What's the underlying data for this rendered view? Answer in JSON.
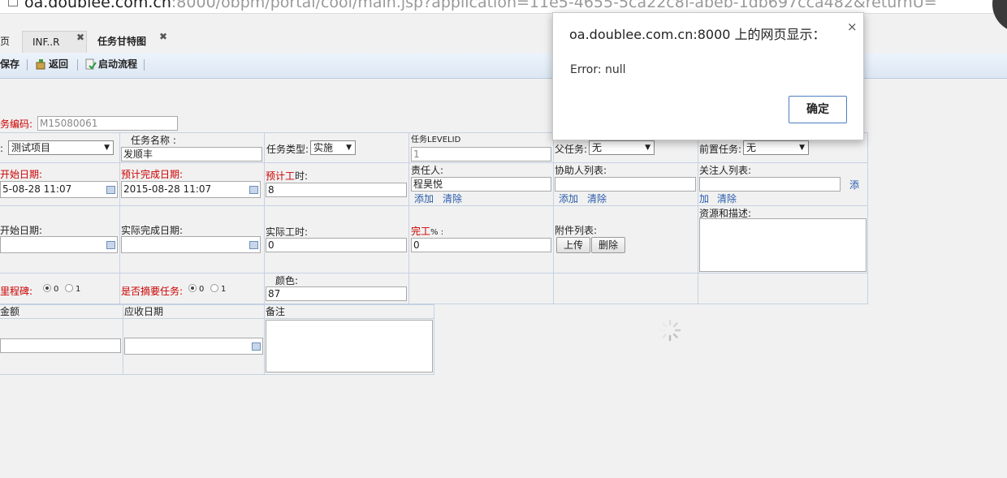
{
  "address_bar": {
    "host": "oa.doublee.com.cn",
    "rest": ":8000/obpm/portal/cool/main.jsp?application=11e5-4655-5ca22c8f-abeb-1db697cca482&returnU="
  },
  "tabs": [
    {
      "label": "页",
      "closable": false
    },
    {
      "label": "INF..R",
      "closable": true
    },
    {
      "label": "任务甘特图",
      "closable": true
    }
  ],
  "toolbar": {
    "save_label": "保存",
    "back_label": "返回",
    "start_flow_label": "启动流程"
  },
  "form": {
    "task_code": {
      "label": "务编码:",
      "value": "M15080061"
    },
    "project": {
      "value": "测试项目"
    },
    "task_name": {
      "label": "任务名称 :",
      "value": "发顺丰"
    },
    "task_type": {
      "label": "任务类型:",
      "value": "实施"
    },
    "task_level": {
      "label": "任务LEVELID",
      "value": "1"
    },
    "parent_task": {
      "label": "父任务:",
      "value": "无"
    },
    "pre_task": {
      "label": "前置任务:",
      "value": "无"
    },
    "plan_start": {
      "label": "开始日期:",
      "value": "5-08-28 11:07"
    },
    "plan_finish": {
      "label": "预计完成日期:",
      "value": "2015-08-28 11:07"
    },
    "plan_hours": {
      "label_a": "预计工",
      "label_b": "时:",
      "value": "8"
    },
    "owner": {
      "label": "责任人:",
      "value": "程昊悦",
      "add": "添加",
      "clear": "清除"
    },
    "assistants": {
      "label": "协助人列表:",
      "value": "",
      "add": "添加",
      "clear": "清除"
    },
    "watchers": {
      "label": "关注人列表:",
      "value": "",
      "add_tail": "添",
      "add": "加",
      "clear": "清除"
    },
    "actual_start": {
      "label": "开始日期:",
      "value": ""
    },
    "actual_finish": {
      "label": "实际完成日期:",
      "value": ""
    },
    "actual_hours": {
      "label": "实际工时:",
      "value": "0"
    },
    "complete_pct": {
      "label_a": "完工",
      "label_b": "% :",
      "value": "0"
    },
    "attachments": {
      "label": "附件列表:",
      "upload": "上传",
      "delete": "删除"
    },
    "resources": {
      "label": "资源和描述:"
    },
    "milestone": {
      "label": "里程碑:",
      "opt0": "0",
      "opt1": "1",
      "selected": "0"
    },
    "summary_task": {
      "label": "是否摘要任务:",
      "opt0": "0",
      "opt1": "1",
      "selected": "0"
    },
    "color": {
      "label": "颜色:",
      "value": "87"
    },
    "amount": {
      "label": "金额",
      "value": ""
    },
    "receivable_date": {
      "label": "应收日期",
      "value": ""
    },
    "remarks": {
      "label": "备注"
    }
  },
  "dialog": {
    "title": "oa.doublee.com.cn:8000 上的网页显示：",
    "message": "Error: null",
    "ok_label": "确定",
    "close_glyph": "×"
  },
  "colors": {
    "required_label": "#cc0000",
    "link": "#2a5cab",
    "toolbar_bg": "#e3ecf6"
  }
}
